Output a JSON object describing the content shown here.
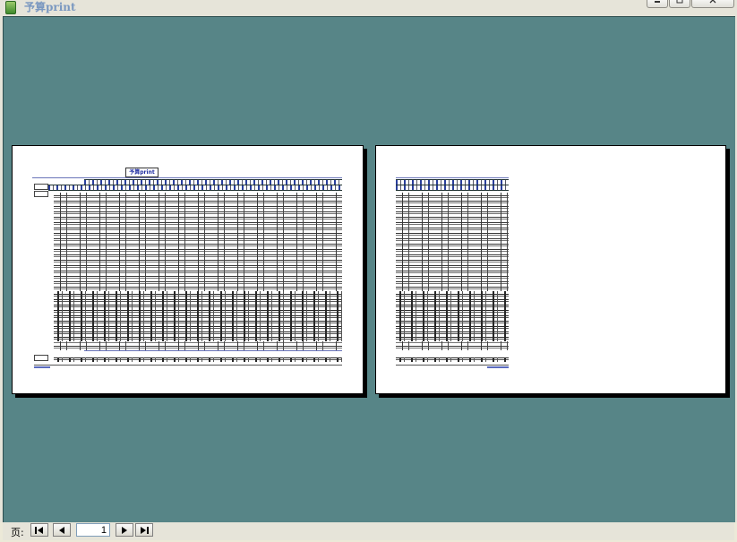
{
  "window": {
    "title": "予算print",
    "buttons": {
      "minimize": "minimize-icon",
      "restore": "restore-icon",
      "close": "close-icon"
    }
  },
  "preview": {
    "background_color": "#578587",
    "report_title": "予算print",
    "pages": [
      {
        "label": "page-1"
      },
      {
        "label": "page-2"
      }
    ]
  },
  "navigation": {
    "page_label": "页:",
    "current_page": "1",
    "icons": {
      "first": "first-page-icon",
      "prev": "prev-page-icon",
      "next": "next-page-icon",
      "last": "last-page-icon"
    }
  }
}
